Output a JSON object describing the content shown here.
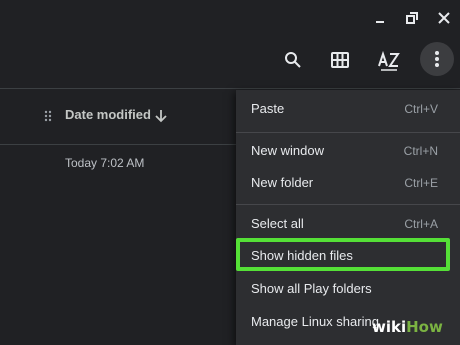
{
  "window_controls": [
    {
      "name": "minimize",
      "icon": "minimize-icon"
    },
    {
      "name": "restore",
      "icon": "restore-icon"
    },
    {
      "name": "close",
      "icon": "close-icon"
    }
  ],
  "toolbar": {
    "buttons": [
      {
        "name": "search",
        "icon": "search-icon"
      },
      {
        "name": "grid-view",
        "icon": "grid-view-icon"
      },
      {
        "name": "sort",
        "icon": "sort-az-icon"
      },
      {
        "name": "more",
        "icon": "more-vert-icon"
      }
    ]
  },
  "file_list": {
    "column_header": {
      "label": "Date modified",
      "sort": "descending"
    },
    "rows": [
      {
        "date_modified": "Today 7:02 AM"
      }
    ]
  },
  "menu": {
    "items": [
      {
        "label": "Paste",
        "shortcut": "Ctrl+V"
      },
      {
        "label": "New window",
        "shortcut": "Ctrl+N"
      },
      {
        "label": "New folder",
        "shortcut": "Ctrl+E"
      },
      {
        "label": "Select all",
        "shortcut": "Ctrl+A"
      },
      {
        "label": "Show hidden files",
        "shortcut": ""
      },
      {
        "label": "Show all Play folders",
        "shortcut": ""
      },
      {
        "label": "Manage Linux sharing",
        "shortcut": ""
      }
    ],
    "highlighted_item": "Show hidden files"
  },
  "watermark": {
    "part1": "wiki",
    "part2": "How"
  },
  "colors": {
    "background": "#202124",
    "menu": "#2d2e31",
    "highlight": "#55e037",
    "watermark_green": "#7bb342"
  }
}
